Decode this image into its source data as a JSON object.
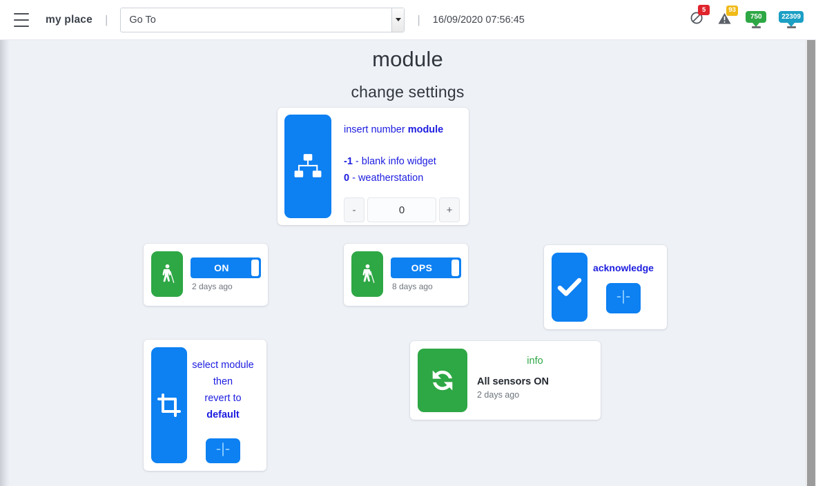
{
  "colors": {
    "blue": "#0d80f2",
    "green": "#2ea745",
    "link_blue": "#1c1ce0",
    "page_bg": "#eef1f6",
    "badge_red": "#e0242c",
    "badge_yellow": "#f0ba17",
    "badge_green": "#2ea745",
    "badge_teal": "#1b9fc4"
  },
  "header": {
    "menu_icon": "hamburger-icon",
    "brand": "my place",
    "separator": "|",
    "goto": {
      "label": "Go To",
      "placeholder": "Go To",
      "arrow_icon": "chevron-down-icon"
    },
    "timestamp": "16/09/2020 07:56:45",
    "status_icons": [
      {
        "name": "no-entry-icon",
        "count": "5",
        "color": "#e0242c"
      },
      {
        "name": "warning-triangle-icon",
        "count": "93",
        "color": "#f0ba17"
      },
      {
        "name": "map-pin-icon",
        "count": "750",
        "color": "#2ea745"
      },
      {
        "name": "map-pin-icon",
        "count": "22309",
        "color": "#1b9fc4"
      }
    ]
  },
  "main": {
    "title": "module",
    "subtitle": "change settings",
    "module_card": {
      "icon": "sitemap-icon",
      "heading_plain": "insert number ",
      "heading_bold": "module",
      "options": [
        {
          "value": "-1",
          "label": " - blank info widget"
        },
        {
          "value": "0",
          "label": " - weatherstation"
        }
      ],
      "stepper": {
        "minus_label": "-",
        "value": "0",
        "plus_label": "+"
      }
    },
    "toggles": [
      {
        "icon": "blind-person-icon",
        "state_label": "ON",
        "timestamp": "2 days ago"
      },
      {
        "icon": "blind-person-icon",
        "state_label": "OPS",
        "timestamp": "8 days ago"
      }
    ],
    "acknowledge_card": {
      "icon": "check-icon",
      "title": "acknowledge",
      "button_icon": "minus-vertical-icon"
    },
    "default_card": {
      "icon": "crop-icon",
      "lines": [
        "select module",
        "then",
        "revert to"
      ],
      "bold_line": "default",
      "button_icon": "minus-vertical-icon"
    },
    "info_card": {
      "icon": "sync-icon",
      "heading": "info",
      "message": "All sensors ON",
      "timestamp": "2 days ago"
    }
  }
}
